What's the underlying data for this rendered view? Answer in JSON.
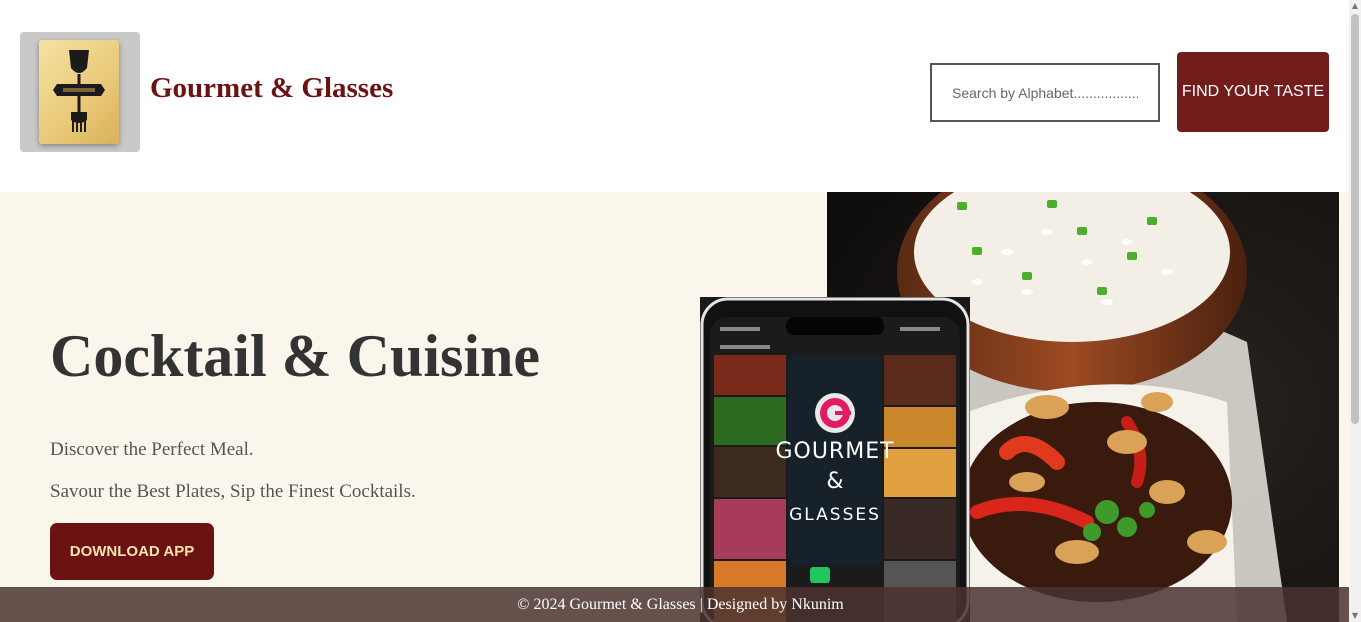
{
  "header": {
    "brand_title": "Gourmet & Glasses",
    "logo_icon": "wine-glass-fork-logo-icon",
    "search": {
      "placeholder": "Search by Alphabet..................",
      "value": ""
    },
    "find_button_label": "FIND YOUR TASTE"
  },
  "hero": {
    "title": "Cocktail & Cuisine",
    "line1": "Discover the Perfect Meal.",
    "line2": "Savour the Best Plates, Sip the Finest Cocktails.",
    "download_button_label": "DOWNLOAD APP"
  },
  "phone_app": {
    "logo_letter": "G",
    "name_line1": "GOURMET",
    "name_line2": "&",
    "name_line3": "GLASSES"
  },
  "footer": {
    "text": "© 2024 Gourmet & Glasses | Designed by Nkunim"
  },
  "colors": {
    "brand": "#6b1212",
    "button": "#731c1c",
    "hero_bg": "#fbf6ec",
    "text_dark": "#333333",
    "text_muted": "#555555",
    "download_text": "#f6e3b0",
    "footer_bg": "#4b3230"
  }
}
